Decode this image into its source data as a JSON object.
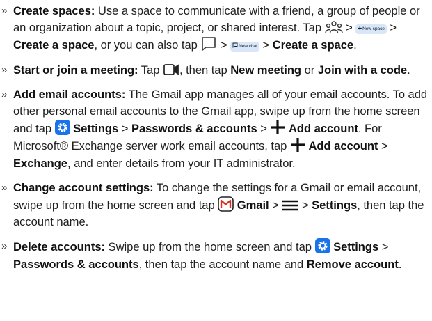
{
  "bullet_glyph": "»",
  "icons": {
    "people": "people-icon",
    "chat": "chat-bubble-icon",
    "video": "video-camera-icon",
    "gear": "settings-gear-icon",
    "plus": "plus-icon",
    "gmail": "gmail-icon",
    "menu": "hamburger-menu-icon"
  },
  "colors": {
    "settings_badge": "#1a73e8",
    "chip_bg": "#d8e6f7",
    "gmail_red": "#d93025"
  },
  "items": [
    {
      "title": "Create spaces:",
      "t1": " Use a space to communicate with a friend, a group of people or an organization about a topic, project, or shared interest. Tap ",
      "sep1": " > ",
      "chip1": "New space",
      "sep2": " > ",
      "b1": "Create a space",
      "t2": ", or you can also tap ",
      "sep3": " > ",
      "chip2": "New chat",
      "sep4": " > ",
      "b2": "Create a space",
      "end": "."
    },
    {
      "title": "Start or join a meeting:",
      "t1": " Tap ",
      "t2": ", then tap ",
      "b1": "New meeting",
      "t3": " or ",
      "b2": "Join with a code",
      "end": "."
    },
    {
      "title": "Add email accounts:",
      "t1": " The Gmail app manages all of your email accounts. To add other personal email accounts to the Gmail app, swipe up from the home screen and tap ",
      "b1": "Settings",
      "sep1": " > ",
      "b2": "Passwords & accounts",
      "sep2": " > ",
      "b3": "Add account",
      "t2": ". For Microsoft® Exchange server work email accounts, tap ",
      "b4": "Add account",
      "sep3": " > ",
      "b5": "Exchange",
      "t3": ", and enter details from your IT administrator."
    },
    {
      "title": "Change account settings:",
      "t1": " To change the settings for a Gmail or email account, swipe up from the home screen and tap ",
      "b1": "Gmail",
      "sep1": " > ",
      "sep2": " > ",
      "b2": "Settings",
      "t2": ", then tap the account name."
    },
    {
      "title": "Delete accounts:",
      "t1": " Swipe up from the home screen and tap ",
      "b1": "Settings",
      "sep1": " > ",
      "b2": "Passwords & accounts",
      "t2": ", then tap the account name and ",
      "b3": "Remove account",
      "end": "."
    }
  ]
}
